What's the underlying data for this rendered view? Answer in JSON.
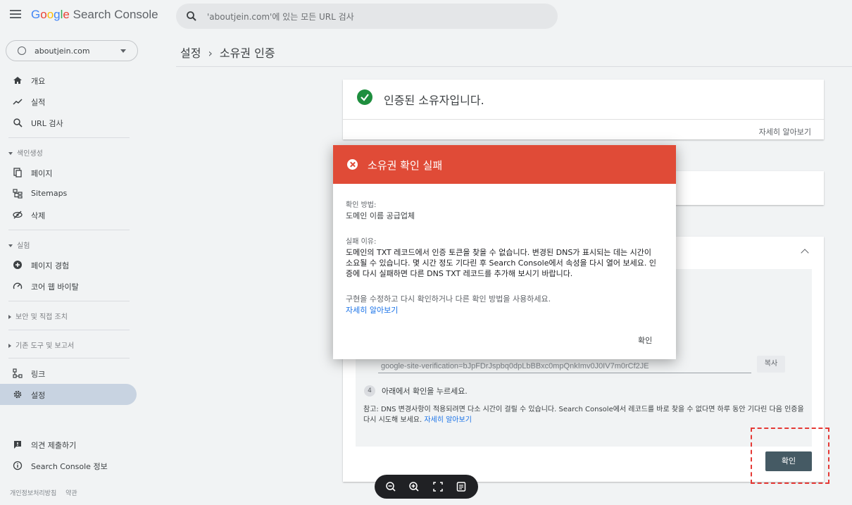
{
  "app": {
    "brand_google": "Google",
    "brand_product": "Search Console"
  },
  "search": {
    "placeholder": "'aboutjein.com'에 있는 모든 URL 검사"
  },
  "property": {
    "name": "aboutjein.com"
  },
  "sidebar": {
    "items": [
      {
        "label": "개요",
        "icon": "home-icon"
      },
      {
        "label": "실적",
        "icon": "trending-icon"
      },
      {
        "label": "URL 검사",
        "icon": "search-icon"
      }
    ],
    "section_indexing": "색인생성",
    "indexing_items": [
      {
        "label": "페이지",
        "icon": "pages-icon"
      },
      {
        "label": "Sitemaps",
        "icon": "sitemap-icon"
      },
      {
        "label": "삭제",
        "icon": "removal-icon"
      }
    ],
    "section_experience": "실험",
    "experience_items": [
      {
        "label": "페이지 경험",
        "icon": "plus-circle-icon"
      },
      {
        "label": "코어 웹 바이탈",
        "icon": "gauge-icon"
      }
    ],
    "section_security": "보안 및 직접 조치",
    "section_legacy": "기존 도구 및 보고서",
    "bottom_items": [
      {
        "label": "링크",
        "icon": "links-icon"
      },
      {
        "label": "설정",
        "icon": "gear-icon"
      }
    ],
    "footer_items": [
      {
        "label": "의견 제출하기",
        "icon": "feedback-icon"
      },
      {
        "label": "Search Console 정보",
        "icon": "info-icon"
      }
    ],
    "footer_links": [
      "개인정보처리방침",
      "약관"
    ]
  },
  "breadcrumb": {
    "parent": "설정",
    "separator": "›",
    "current": "소유권 인증"
  },
  "verified_card": {
    "title": "인증된 소유자입니다.",
    "learn_more": "자세히 알아보기"
  },
  "verification": {
    "record": "google-site-verification=bJpFDrJspbq0dpLbBBxc0mpQnkImv0J0IV7m0rCf2JE",
    "copy_label": "복사",
    "step4_number": "4",
    "step4_text": "아래에서 확인을 누르세요.",
    "note_text": "참고: DNS 변경사항이 적용되려면 다소 시간이 걸릴 수 있습니다. Search Console에서 레코드를 바로 찾을 수 없다면 하루 동안 기다린 다음 인증을 다시 시도해 보세요.",
    "note_link": "자세히 알아보기",
    "confirm_label": "확인"
  },
  "dialog": {
    "title": "소유권 확인 실패",
    "method_label": "확인 방법:",
    "method_value": "도메인 이름 공급업체",
    "reason_label": "실패 이유:",
    "reason_text": "도메인의 TXT 레코드에서 인증 토큰을 찾을 수 없습니다. 변경된 DNS가 표시되는 데는 시간이 소요될 수 있습니다. 몇 시간 정도 기다린 후 Search Console에서 속성을 다시 열어 보세요. 인증에 다시 실패하면 다른 DNS TXT 레코드를 추가해 보시기 바랍니다.",
    "hint_text": "구현을 수정하고 다시 확인하거나 다른 확인 방법을 사용하세요.",
    "hint_link": "자세히 알아보기",
    "ok_label": "확인",
    "header_color": "#e04b37"
  },
  "zoombar": {
    "buttons": [
      "zoom-out-icon",
      "zoom-in-icon",
      "fullscreen-icon",
      "notes-icon"
    ]
  }
}
